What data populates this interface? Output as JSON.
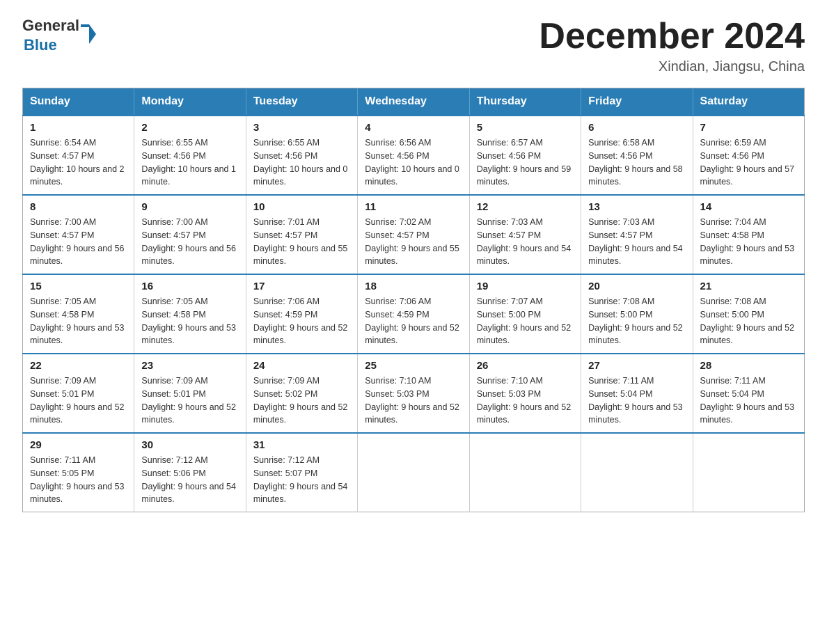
{
  "header": {
    "logo_general": "General",
    "logo_blue": "Blue",
    "month_title": "December 2024",
    "location": "Xindian, Jiangsu, China"
  },
  "days_of_week": [
    "Sunday",
    "Monday",
    "Tuesday",
    "Wednesday",
    "Thursday",
    "Friday",
    "Saturday"
  ],
  "weeks": [
    [
      {
        "day": "1",
        "sunrise": "6:54 AM",
        "sunset": "4:57 PM",
        "daylight": "10 hours and 2 minutes."
      },
      {
        "day": "2",
        "sunrise": "6:55 AM",
        "sunset": "4:56 PM",
        "daylight": "10 hours and 1 minute."
      },
      {
        "day": "3",
        "sunrise": "6:55 AM",
        "sunset": "4:56 PM",
        "daylight": "10 hours and 0 minutes."
      },
      {
        "day": "4",
        "sunrise": "6:56 AM",
        "sunset": "4:56 PM",
        "daylight": "10 hours and 0 minutes."
      },
      {
        "day": "5",
        "sunrise": "6:57 AM",
        "sunset": "4:56 PM",
        "daylight": "9 hours and 59 minutes."
      },
      {
        "day": "6",
        "sunrise": "6:58 AM",
        "sunset": "4:56 PM",
        "daylight": "9 hours and 58 minutes."
      },
      {
        "day": "7",
        "sunrise": "6:59 AM",
        "sunset": "4:56 PM",
        "daylight": "9 hours and 57 minutes."
      }
    ],
    [
      {
        "day": "8",
        "sunrise": "7:00 AM",
        "sunset": "4:57 PM",
        "daylight": "9 hours and 56 minutes."
      },
      {
        "day": "9",
        "sunrise": "7:00 AM",
        "sunset": "4:57 PM",
        "daylight": "9 hours and 56 minutes."
      },
      {
        "day": "10",
        "sunrise": "7:01 AM",
        "sunset": "4:57 PM",
        "daylight": "9 hours and 55 minutes."
      },
      {
        "day": "11",
        "sunrise": "7:02 AM",
        "sunset": "4:57 PM",
        "daylight": "9 hours and 55 minutes."
      },
      {
        "day": "12",
        "sunrise": "7:03 AM",
        "sunset": "4:57 PM",
        "daylight": "9 hours and 54 minutes."
      },
      {
        "day": "13",
        "sunrise": "7:03 AM",
        "sunset": "4:57 PM",
        "daylight": "9 hours and 54 minutes."
      },
      {
        "day": "14",
        "sunrise": "7:04 AM",
        "sunset": "4:58 PM",
        "daylight": "9 hours and 53 minutes."
      }
    ],
    [
      {
        "day": "15",
        "sunrise": "7:05 AM",
        "sunset": "4:58 PM",
        "daylight": "9 hours and 53 minutes."
      },
      {
        "day": "16",
        "sunrise": "7:05 AM",
        "sunset": "4:58 PM",
        "daylight": "9 hours and 53 minutes."
      },
      {
        "day": "17",
        "sunrise": "7:06 AM",
        "sunset": "4:59 PM",
        "daylight": "9 hours and 52 minutes."
      },
      {
        "day": "18",
        "sunrise": "7:06 AM",
        "sunset": "4:59 PM",
        "daylight": "9 hours and 52 minutes."
      },
      {
        "day": "19",
        "sunrise": "7:07 AM",
        "sunset": "5:00 PM",
        "daylight": "9 hours and 52 minutes."
      },
      {
        "day": "20",
        "sunrise": "7:08 AM",
        "sunset": "5:00 PM",
        "daylight": "9 hours and 52 minutes."
      },
      {
        "day": "21",
        "sunrise": "7:08 AM",
        "sunset": "5:00 PM",
        "daylight": "9 hours and 52 minutes."
      }
    ],
    [
      {
        "day": "22",
        "sunrise": "7:09 AM",
        "sunset": "5:01 PM",
        "daylight": "9 hours and 52 minutes."
      },
      {
        "day": "23",
        "sunrise": "7:09 AM",
        "sunset": "5:01 PM",
        "daylight": "9 hours and 52 minutes."
      },
      {
        "day": "24",
        "sunrise": "7:09 AM",
        "sunset": "5:02 PM",
        "daylight": "9 hours and 52 minutes."
      },
      {
        "day": "25",
        "sunrise": "7:10 AM",
        "sunset": "5:03 PM",
        "daylight": "9 hours and 52 minutes."
      },
      {
        "day": "26",
        "sunrise": "7:10 AM",
        "sunset": "5:03 PM",
        "daylight": "9 hours and 52 minutes."
      },
      {
        "day": "27",
        "sunrise": "7:11 AM",
        "sunset": "5:04 PM",
        "daylight": "9 hours and 53 minutes."
      },
      {
        "day": "28",
        "sunrise": "7:11 AM",
        "sunset": "5:04 PM",
        "daylight": "9 hours and 53 minutes."
      }
    ],
    [
      {
        "day": "29",
        "sunrise": "7:11 AM",
        "sunset": "5:05 PM",
        "daylight": "9 hours and 53 minutes."
      },
      {
        "day": "30",
        "sunrise": "7:12 AM",
        "sunset": "5:06 PM",
        "daylight": "9 hours and 54 minutes."
      },
      {
        "day": "31",
        "sunrise": "7:12 AM",
        "sunset": "5:07 PM",
        "daylight": "9 hours and 54 minutes."
      },
      null,
      null,
      null,
      null
    ]
  ],
  "labels": {
    "sunrise": "Sunrise:",
    "sunset": "Sunset:",
    "daylight": "Daylight:"
  }
}
